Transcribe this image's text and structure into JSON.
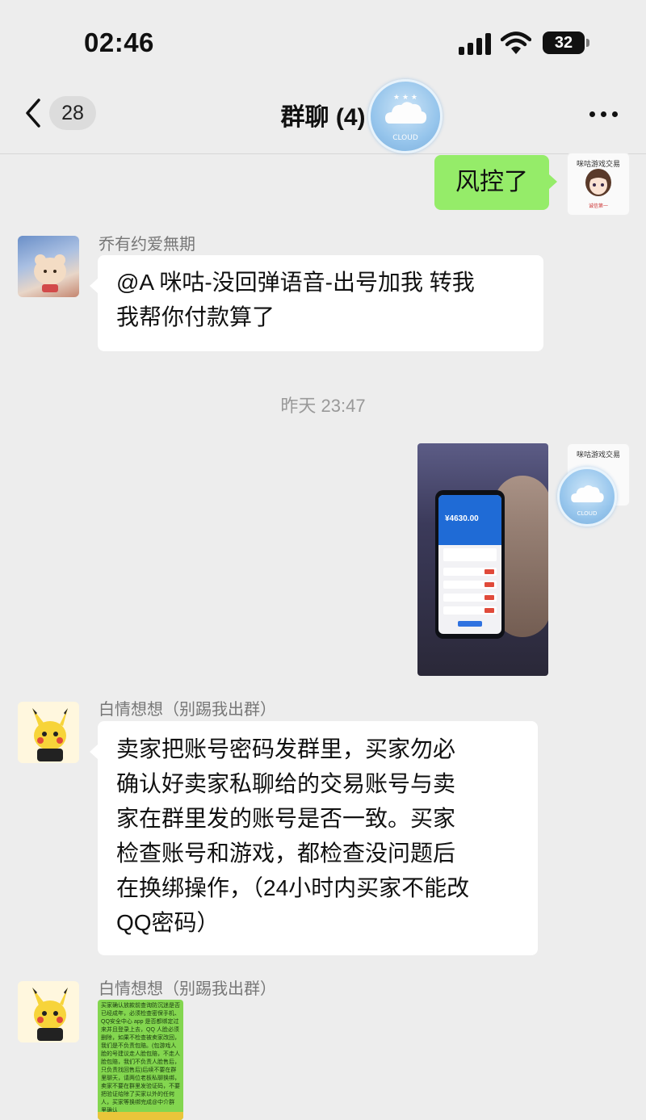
{
  "status_bar": {
    "time": "02:46",
    "battery": "32"
  },
  "nav": {
    "back_badge": "28",
    "title": "群聊 (4)"
  },
  "watermark": {
    "text": "CLOUD"
  },
  "self_avatar": {
    "brand": "咪咕游戏交易",
    "stamp": "诚信第一"
  },
  "messages": {
    "m1": {
      "text": "风控了"
    },
    "m2": {
      "sender": "乔有约爱無期",
      "text_line1": "@A 咪咕-没回弹语音-出号加我 转我",
      "text_line2": "我帮你付款算了"
    },
    "time_divider": "昨天 23:47",
    "m3": {
      "amount": "¥4630.00"
    },
    "m4": {
      "sender": "白情想想（别踢我出群）",
      "lines": [
        "卖家把账号密码发群里，买家勿必",
        "确认好卖家私聊给的交易账号与卖",
        "家在群里发的账号是否一致。买家",
        "检查账号和游戏，都检查没问题后",
        "在换绑操作，（24小时内买家不能改",
        "QQ密码）"
      ]
    },
    "m5": {
      "sender": "白情想想（别踢我出群）",
      "note_text": "买家确认放款前查询防沉迷是否已经成年，必须检查密保手机、QQ安全中心 app 是否都绑定过来并且登录上去，QQ 人脸必须删除，如果不检查被卖家改回，我们是不负责包赔。(包游戏人脸的号建议走人脸包赔，不走人脸包赔，我们不负责人脸售后，只负责找回售后)后续不要在群里聊天，请两位老板私聊换绑，卖家不要在群里发验证码，不要把验证给除了买家以外的任何人，买家等换绑完成@中介群里确认"
    }
  },
  "colors": {
    "background": "#ededed",
    "bubble_self": "#95ec69",
    "bubble_other": "#ffffff",
    "timestamp": "#999999"
  }
}
